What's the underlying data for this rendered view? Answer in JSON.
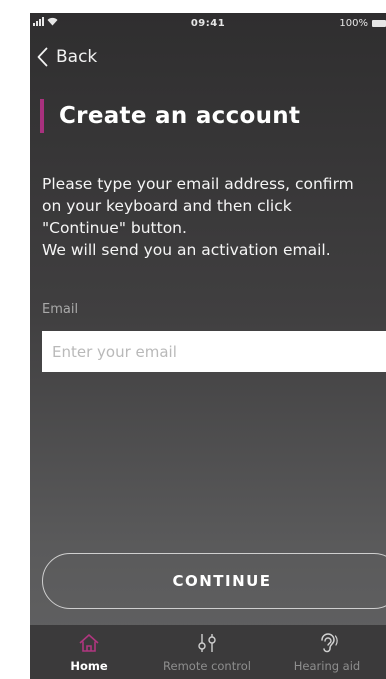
{
  "status_bar": {
    "time": "09:41",
    "battery": "100%"
  },
  "nav": {
    "back_label": "Back"
  },
  "page": {
    "title": "Create an account"
  },
  "instructions": {
    "lines": [
      "Please type your email address, confirm",
      "on your keyboard and then click",
      "\"Continue\" button.",
      "We will send you an activation email."
    ]
  },
  "form": {
    "email_label": "Email",
    "email_placeholder": "Enter your email",
    "email_value": ""
  },
  "continue_label": "CONTINUE",
  "tabs": [
    {
      "label": "Home",
      "icon": "home-icon",
      "active": true
    },
    {
      "label": "Remote control",
      "icon": "sliders-icon",
      "active": false
    },
    {
      "label": "Hearing aid",
      "icon": "ear-icon",
      "active": false
    }
  ],
  "colors": {
    "accent": "#a8317e",
    "home_tab_icon": "#b0367f"
  }
}
